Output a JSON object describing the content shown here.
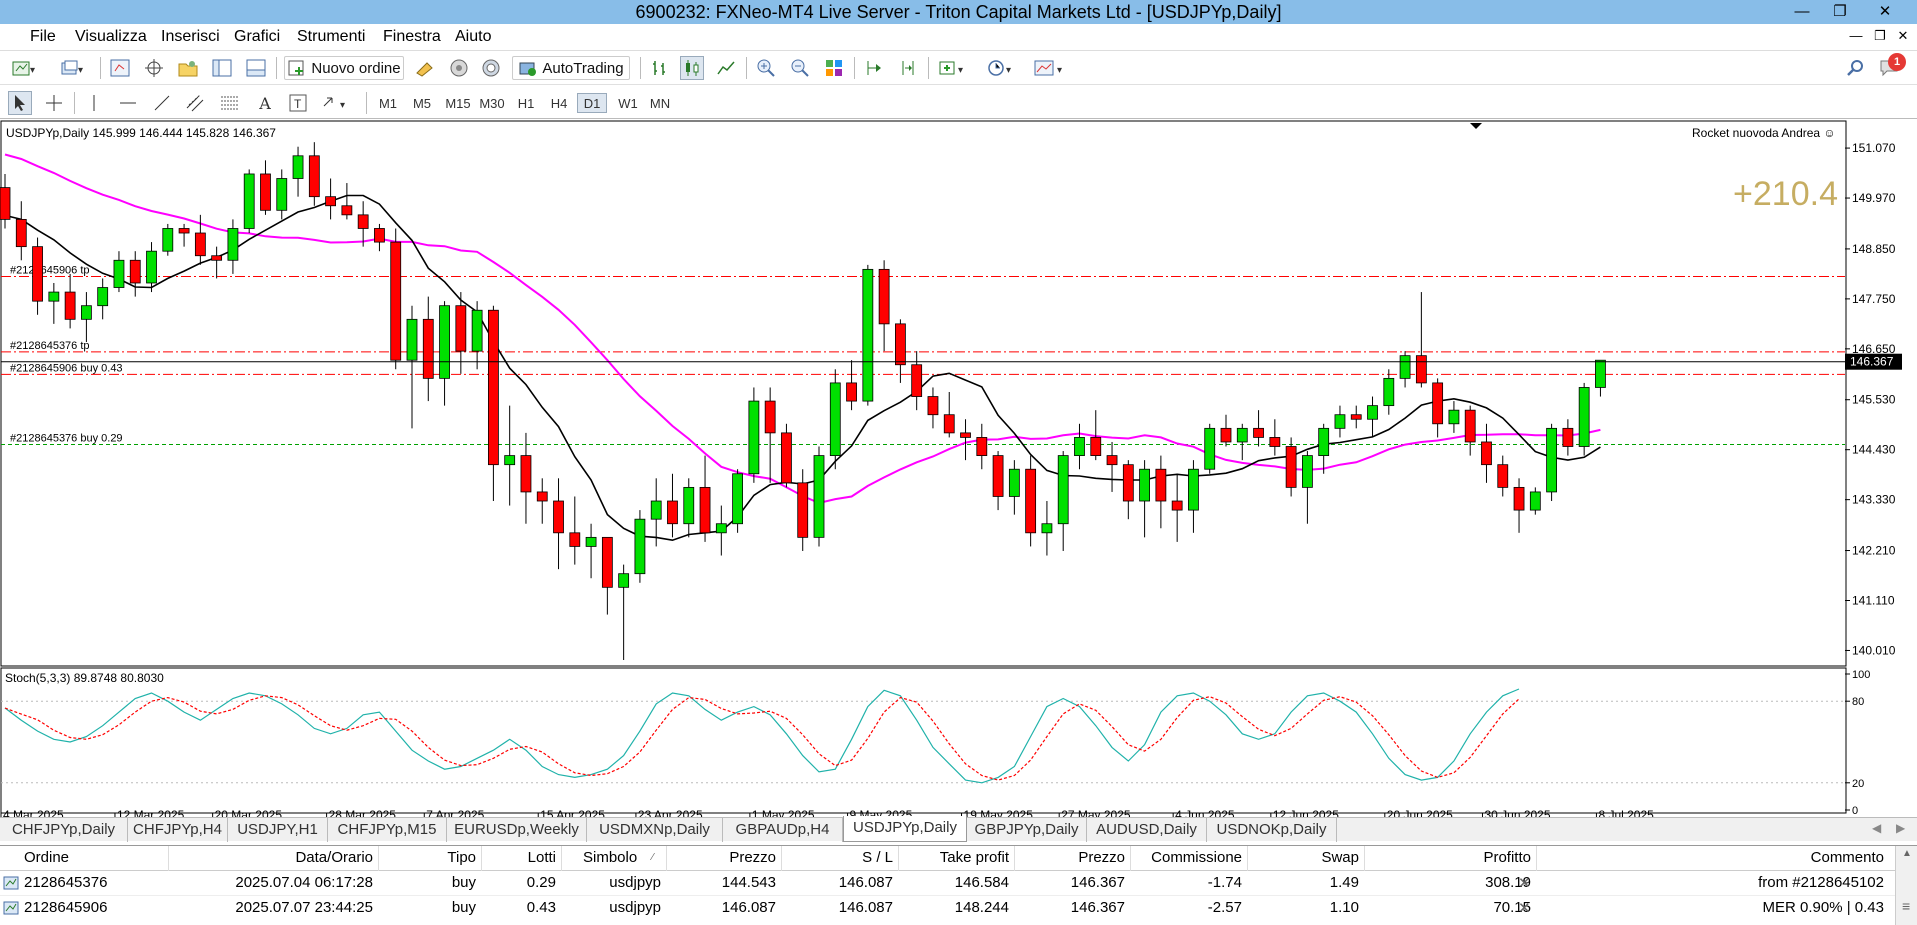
{
  "window": {
    "title": "6900232: FXNeo-MT4 Live Server - Triton Capital Markets Ltd - [USDJPYp,Daily]"
  },
  "menu": [
    "File",
    "Visualizza",
    "Inserisci",
    "Grafici",
    "Strumenti",
    "Finestra",
    "Aiuto"
  ],
  "toolbar": {
    "new_order_label": "Nuovo ordine",
    "autotrading_label": "AutoTrading",
    "notification_count": "1"
  },
  "timeframes": [
    "M1",
    "M5",
    "M15",
    "M30",
    "H1",
    "H4",
    "D1",
    "W1",
    "MN"
  ],
  "active_timeframe": "D1",
  "chart": {
    "header": "USDJPYp,Daily  145.999 146.444 145.828 146.367",
    "ea_name": "Rocket nuovoda Andrea ☺",
    "profit_display": "+210.4",
    "current_price": "146.367",
    "price_ticks": [
      "151.070",
      "149.970",
      "148.850",
      "147.750",
      "146.650",
      "145.530",
      "144.430",
      "143.330",
      "142.210",
      "141.110",
      "140.010"
    ],
    "level_labels": [
      {
        "text": "#2128645906 tp",
        "price": 148.244
      },
      {
        "text": "#2128645376 tp",
        "price": 146.584
      },
      {
        "text": "#2128645906 buy 0.43",
        "price": 146.087
      },
      {
        "text": "#2128645376 buy 0.29",
        "price": 144.543
      }
    ],
    "date_ticks": [
      "4 Mar 2025",
      "12 Mar 2025",
      "20 Mar 2025",
      "28 Mar 2025",
      "7 Apr 2025",
      "15 Apr 2025",
      "23 Apr 2025",
      "1 May 2025",
      "9 May 2025",
      "19 May 2025",
      "27 May 2025",
      "4 Jun 2025",
      "12 Jun 2025",
      "20 Jun 2025",
      "30 Jun 2025",
      "8 Jul 2025"
    ],
    "stoch_header": "Stoch(5,3,3) 89.8748 80.8030",
    "stoch_ticks": [
      "100",
      "80",
      "20",
      "0"
    ],
    "colors": {
      "bull": "#00e000",
      "bear": "#ff0000",
      "ma_fast": "#000000",
      "ma_slow": "#ff00ff",
      "stoch_main": "#20b2aa",
      "stoch_signal": "#ff0000",
      "tp_line": "#ff0000",
      "entry_line": "#00a000"
    }
  },
  "chart_data": {
    "type": "candlestick",
    "symbol": "USDJPYp",
    "timeframe": "Daily",
    "ylim": [
      139.8,
      151.6
    ],
    "candles": [
      [
        150.2,
        150.5,
        149.3,
        149.5
      ],
      [
        149.5,
        149.9,
        148.6,
        148.9
      ],
      [
        148.9,
        149.1,
        147.4,
        147.7
      ],
      [
        147.7,
        148.1,
        147.2,
        147.9
      ],
      [
        147.9,
        148.3,
        147.1,
        147.3
      ],
      [
        147.3,
        147.9,
        146.8,
        147.6
      ],
      [
        147.6,
        148.2,
        147.3,
        148.0
      ],
      [
        148.0,
        148.8,
        147.9,
        148.6
      ],
      [
        148.6,
        148.8,
        147.8,
        148.1
      ],
      [
        148.1,
        149.0,
        147.9,
        148.8
      ],
      [
        148.8,
        149.4,
        148.7,
        149.3
      ],
      [
        149.3,
        149.4,
        148.9,
        149.2
      ],
      [
        149.2,
        149.6,
        148.5,
        148.7
      ],
      [
        148.7,
        148.9,
        148.2,
        148.6
      ],
      [
        148.6,
        149.5,
        148.3,
        149.3
      ],
      [
        149.3,
        150.6,
        149.2,
        150.5
      ],
      [
        150.5,
        150.8,
        149.6,
        149.7
      ],
      [
        149.7,
        150.6,
        149.5,
        150.4
      ],
      [
        150.4,
        151.1,
        150.0,
        150.9
      ],
      [
        150.9,
        151.2,
        149.8,
        150.0
      ],
      [
        150.0,
        150.4,
        149.5,
        149.8
      ],
      [
        149.8,
        150.3,
        149.5,
        149.6
      ],
      [
        149.6,
        149.9,
        148.9,
        149.3
      ],
      [
        149.3,
        149.4,
        148.8,
        149.0
      ],
      [
        149.0,
        149.3,
        146.2,
        146.4
      ],
      [
        146.4,
        147.6,
        144.9,
        147.3
      ],
      [
        147.3,
        147.8,
        145.5,
        146.0
      ],
      [
        146.0,
        147.7,
        145.4,
        147.6
      ],
      [
        147.6,
        147.9,
        146.1,
        146.6
      ],
      [
        146.6,
        147.7,
        146.2,
        147.5
      ],
      [
        147.5,
        147.6,
        143.3,
        144.1
      ],
      [
        144.1,
        145.4,
        143.2,
        144.3
      ],
      [
        144.3,
        144.8,
        142.8,
        143.5
      ],
      [
        143.5,
        143.8,
        142.8,
        143.3
      ],
      [
        143.3,
        143.8,
        141.8,
        142.6
      ],
      [
        142.6,
        143.4,
        141.9,
        142.3
      ],
      [
        142.3,
        142.8,
        141.6,
        142.5
      ],
      [
        142.5,
        142.5,
        140.8,
        141.4
      ],
      [
        141.4,
        141.9,
        139.8,
        141.7
      ],
      [
        141.7,
        143.1,
        141.5,
        142.9
      ],
      [
        142.9,
        143.8,
        142.3,
        143.3
      ],
      [
        143.3,
        143.9,
        142.5,
        142.8
      ],
      [
        142.8,
        143.8,
        142.5,
        143.6
      ],
      [
        143.6,
        144.3,
        142.4,
        142.6
      ],
      [
        142.6,
        143.2,
        142.1,
        142.8
      ],
      [
        142.8,
        144.0,
        142.6,
        143.9
      ],
      [
        143.9,
        145.8,
        143.7,
        145.5
      ],
      [
        145.5,
        145.8,
        143.7,
        144.8
      ],
      [
        144.8,
        145.0,
        143.6,
        143.7
      ],
      [
        143.7,
        144.0,
        142.2,
        142.5
      ],
      [
        142.5,
        144.5,
        142.3,
        144.3
      ],
      [
        144.3,
        146.2,
        144.0,
        145.9
      ],
      [
        145.9,
        146.4,
        145.3,
        145.5
      ],
      [
        145.5,
        148.5,
        145.4,
        148.4
      ],
      [
        148.4,
        148.6,
        146.6,
        147.2
      ],
      [
        147.2,
        147.3,
        145.9,
        146.3
      ],
      [
        146.3,
        146.6,
        145.3,
        145.6
      ],
      [
        145.6,
        145.8,
        144.9,
        145.2
      ],
      [
        145.2,
        145.7,
        144.7,
        144.8
      ],
      [
        144.8,
        145.1,
        144.2,
        144.7
      ],
      [
        144.7,
        145.0,
        144.0,
        144.3
      ],
      [
        144.3,
        144.4,
        143.1,
        143.4
      ],
      [
        143.4,
        144.2,
        143.0,
        144.0
      ],
      [
        144.0,
        144.3,
        142.3,
        142.6
      ],
      [
        142.6,
        143.3,
        142.1,
        142.8
      ],
      [
        142.8,
        144.4,
        142.2,
        144.3
      ],
      [
        144.3,
        145.0,
        144.0,
        144.7
      ],
      [
        144.7,
        145.3,
        144.2,
        144.3
      ],
      [
        144.3,
        144.6,
        143.5,
        144.1
      ],
      [
        144.1,
        144.2,
        142.9,
        143.3
      ],
      [
        143.3,
        144.2,
        142.5,
        144.0
      ],
      [
        144.0,
        144.3,
        142.7,
        143.3
      ],
      [
        143.3,
        143.9,
        142.4,
        143.1
      ],
      [
        143.1,
        144.2,
        142.6,
        144.0
      ],
      [
        144.0,
        145.0,
        143.9,
        144.9
      ],
      [
        144.9,
        145.2,
        144.5,
        144.6
      ],
      [
        144.6,
        145.0,
        144.2,
        144.9
      ],
      [
        144.9,
        145.3,
        144.5,
        144.7
      ],
      [
        144.7,
        145.1,
        144.3,
        144.5
      ],
      [
        144.5,
        144.7,
        143.4,
        143.6
      ],
      [
        143.6,
        144.4,
        142.8,
        144.3
      ],
      [
        144.3,
        145.0,
        143.9,
        144.9
      ],
      [
        144.9,
        145.4,
        144.7,
        145.2
      ],
      [
        145.2,
        145.4,
        144.9,
        145.1
      ],
      [
        145.1,
        145.6,
        144.7,
        145.4
      ],
      [
        145.4,
        146.2,
        145.2,
        146.0
      ],
      [
        146.0,
        146.6,
        145.8,
        146.5
      ],
      [
        146.5,
        147.9,
        145.8,
        145.9
      ],
      [
        145.9,
        146.0,
        144.7,
        145.0
      ],
      [
        145.0,
        145.5,
        144.8,
        145.3
      ],
      [
        145.3,
        145.4,
        144.3,
        144.6
      ],
      [
        144.6,
        145.0,
        143.7,
        144.1
      ],
      [
        144.1,
        144.3,
        143.4,
        143.6
      ],
      [
        143.6,
        143.8,
        142.6,
        143.1
      ],
      [
        143.1,
        143.6,
        143.0,
        143.5
      ],
      [
        143.5,
        145.0,
        143.3,
        144.9
      ],
      [
        144.9,
        145.1,
        144.3,
        144.5
      ],
      [
        144.5,
        145.9,
        144.3,
        145.8
      ],
      [
        145.8,
        146.1,
        145.6,
        146.4
      ]
    ],
    "stoch_main_pct": [
      75,
      66,
      58,
      52,
      50,
      54,
      62,
      72,
      82,
      86,
      80,
      72,
      66,
      74,
      82,
      86,
      84,
      78,
      70,
      60,
      56,
      60,
      70,
      72,
      58,
      44,
      36,
      30,
      32,
      38,
      44,
      52,
      44,
      32,
      26,
      24,
      26,
      30,
      40,
      58,
      78,
      86,
      84,
      74,
      66,
      72,
      76,
      70,
      56,
      40,
      28,
      30,
      52,
      76,
      88,
      84,
      66,
      46,
      34,
      22,
      20,
      24,
      32,
      54,
      76,
      82,
      76,
      62,
      46,
      36,
      48,
      72,
      84,
      86,
      80,
      70,
      56,
      52,
      56,
      72,
      84,
      86,
      80,
      72,
      56,
      38,
      26,
      22,
      24,
      36,
      56,
      72,
      84,
      89
    ]
  },
  "symbol_tabs": [
    "CHFJPYp,Daily",
    "CHFJPYp,H4",
    "USDJPY,H1",
    "CHFJPYp,M15",
    "EURUSDp,Weekly",
    "USDMXNp,Daily",
    "GBPAUDp,H4",
    "USDJPYp,Daily",
    "GBPJPYp,Daily",
    "AUDUSD,Daily",
    "USDNOKp,Daily"
  ],
  "active_symbol_tab": "USDJPYp,Daily",
  "orders": {
    "columns": [
      "Ordine",
      "Data/Orario",
      "Tipo",
      "Lotti",
      "Simbolo",
      "Prezzo",
      "S / L",
      "Take profit",
      "Prezzo",
      "Commissione",
      "Swap",
      "Profitto",
      "Commento"
    ],
    "rows": [
      {
        "ordine": "2128645376",
        "data": "2025.07.04 06:17:28",
        "tipo": "buy",
        "lotti": "0.29",
        "simbolo": "usdjpyp",
        "prezzo": "144.543",
        "sl": "146.087",
        "tp": "146.584",
        "prezzo_att": "146.367",
        "commissione": "-1.74",
        "swap": "1.49",
        "profitto": "308.19",
        "commento": "from #2128645102"
      },
      {
        "ordine": "2128645906",
        "data": "2025.07.07 23:44:25",
        "tipo": "buy",
        "lotti": "0.43",
        "simbolo": "usdjpyp",
        "prezzo": "146.087",
        "sl": "146.087",
        "tp": "148.244",
        "prezzo_att": "146.367",
        "commissione": "-2.57",
        "swap": "1.10",
        "profitto": "70.15",
        "commento": "MER 0.90% | 0.43"
      }
    ]
  }
}
